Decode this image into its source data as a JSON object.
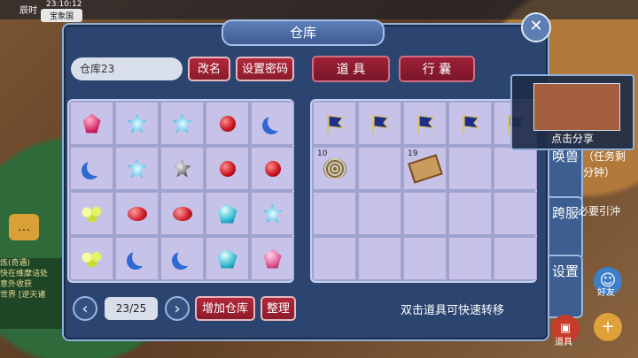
{
  "hud": {
    "time": "23:10:12",
    "channel": "宝象国",
    "status_prefix": "辰时"
  },
  "dialog": {
    "title": "仓库",
    "storage_name": "仓库23",
    "rename_label": "改名",
    "set_password_label": "设置密码",
    "tabs": [
      {
        "label": "道 具"
      },
      {
        "label": "行 囊"
      }
    ],
    "page": "23/25",
    "add_storage_label": "增加仓库",
    "sort_label": "整理",
    "hint": "双击道具可快速转移"
  },
  "storage_items": [
    [
      "gem-pink",
      "gem-cyan",
      "gem-cyan",
      "gem-red",
      "gem-moon"
    ],
    [
      "gem-moon",
      "gem-cyan",
      "gem-black",
      "gem-red",
      "gem-red"
    ],
    [
      "gem-green",
      "gem-redoval",
      "gem-redoval",
      "gem-teal",
      "gem-cyan"
    ],
    [
      "gem-green",
      "gem-moon",
      "gem-moon",
      "gem-teal",
      "gem-rosy"
    ]
  ],
  "bag_items": [
    [
      "flag-icon",
      "flag-icon",
      "flag-icon",
      "flag-icon",
      "flag-icon"
    ],
    [
      {
        "icon": "coil-icon",
        "qty": "10"
      },
      "",
      {
        "icon": "map-icon",
        "qty": "19"
      },
      "",
      ""
    ],
    [
      "",
      "",
      "",
      "",
      ""
    ],
    [
      "",
      "",
      "",
      "",
      ""
    ]
  ],
  "share": {
    "label": "点击分享"
  },
  "side": {
    "tabs": [
      "唤兽",
      "跨服",
      "设置"
    ],
    "quest_text": "（任务剩",
    "quest_text2": "分钟）",
    "misc_text": "必要引沖",
    "friends_label": "好友",
    "items_label": "道具"
  },
  "chat": {
    "lines": [
      "炼(奇遇)",
      "快在维摩诘处",
      "意外收获",
      "世界 [逆天诸"
    ]
  }
}
